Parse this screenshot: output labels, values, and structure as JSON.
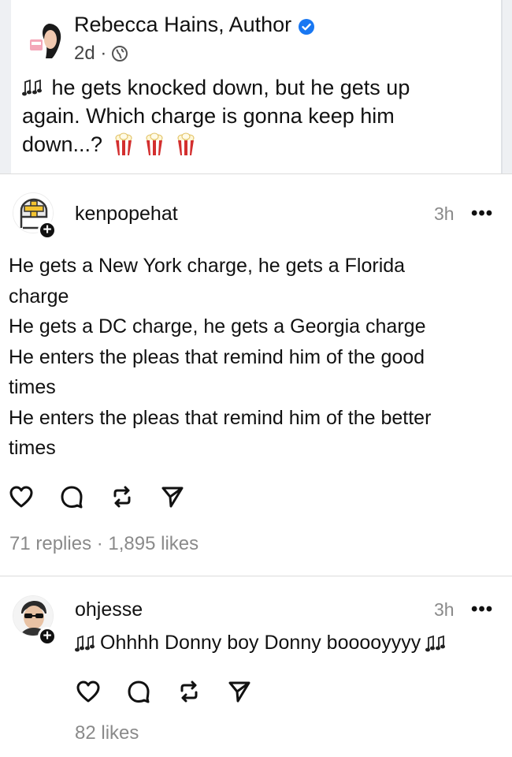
{
  "fb_post": {
    "author": "Rebecca Hains, Author",
    "meta_time": "2d ·",
    "text_lines": [
      "he gets knocked down, but he gets up",
      "again. Which charge is gonna keep him",
      "down...?"
    ],
    "colors": {
      "verified": "#1877f2",
      "popcorn_red": "#d32f2f"
    }
  },
  "threads": [
    {
      "username": "kenpopehat",
      "time": "3h",
      "more": "•••",
      "lines": [
        "He gets a New York charge, he gets a Florida",
        "charge",
        "He gets a DC charge, he gets a Georgia charge",
        "He enters the pleas that remind him of the good",
        "times",
        "He enters the pleas that remind him of the better",
        "times"
      ],
      "stats": "71 replies · 1,895 likes",
      "icons": [
        "heart-icon",
        "comment-icon",
        "repost-icon",
        "send-icon"
      ]
    },
    {
      "username": "ohjesse",
      "time": "3h",
      "more": "•••",
      "text": "Ohhhh Donny boy Donny booooyyyy",
      "stats": "82 likes",
      "icons": [
        "heart-icon",
        "comment-icon",
        "repost-icon",
        "send-icon"
      ]
    }
  ],
  "follow_plus": "+"
}
